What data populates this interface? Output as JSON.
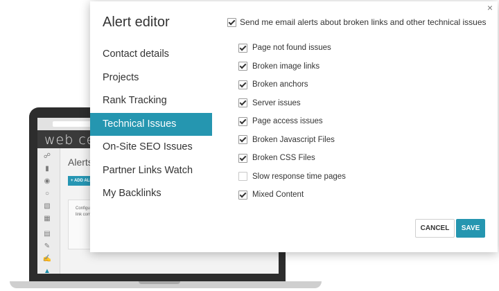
{
  "background_app": {
    "logo": "web ceo",
    "section_title": "Alerts",
    "add_alert_button": "+ ADD ALERT",
    "config_text": "Configure broken link complete",
    "side_icons": [
      "link-icon",
      "bar-chart-icon",
      "location-icon",
      "chat-icon",
      "binoculars-icon",
      "calendar-icon",
      "document-icon",
      "pen-icon",
      "edit-icon",
      "bell-icon"
    ]
  },
  "dialog": {
    "title": "Alert editor",
    "close_label": "×",
    "nav": {
      "items": [
        {
          "label": "Contact details"
        },
        {
          "label": "Projects"
        },
        {
          "label": "Rank Tracking"
        },
        {
          "label": "Technical Issues",
          "active": true
        },
        {
          "label": "On-Site SEO Issues"
        },
        {
          "label": "Partner Links Watch"
        },
        {
          "label": "My Backlinks"
        }
      ]
    },
    "master": {
      "label": "Send me email alerts about broken links and other technical issues",
      "checked": true
    },
    "issues": [
      {
        "label": "Page not found issues",
        "checked": true
      },
      {
        "label": "Broken image links",
        "checked": true
      },
      {
        "label": "Broken anchors",
        "checked": true
      },
      {
        "label": "Server issues",
        "checked": true
      },
      {
        "label": "Page access issues",
        "checked": true
      },
      {
        "label": "Broken Javascript Files",
        "checked": true
      },
      {
        "label": "Broken CSS Files",
        "checked": true
      },
      {
        "label": "Slow response time pages",
        "checked": false
      },
      {
        "label": "Mixed Content",
        "checked": true
      }
    ],
    "cancel_label": "CANCEL",
    "save_label": "SAVE"
  },
  "colors": {
    "accent": "#2596b0",
    "text": "#333333",
    "laptop_frame": "#2d2d2d"
  }
}
